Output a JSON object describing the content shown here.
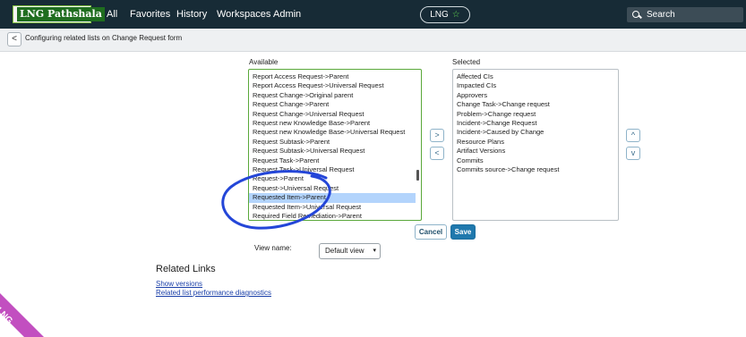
{
  "nav": {
    "logo_text": "LNG Pathshala",
    "links": [
      "All",
      "Favorites",
      "History",
      "Workspaces",
      "Admin"
    ],
    "scope": "LNG",
    "search_placeholder": "Search"
  },
  "header": {
    "back_symbol": "<",
    "title": "Configuring related lists on Change Request form"
  },
  "slushbucket": {
    "available_label": "Available",
    "selected_label": "Selected",
    "available_items": [
      "Report Access Request->Parent",
      "Report Access Request->Universal Request",
      "Request Change->Original parent",
      "Request Change->Parent",
      "Request Change->Universal Request",
      "Request new Knowledge Base->Parent",
      "Request new Knowledge Base->Universal Request",
      "Request Subtask->Parent",
      "Request Subtask->Universal Request",
      "Request Task->Parent",
      "Request Task->Universal Request",
      "Request->Parent",
      "Request->Universal Request",
      "Requested Item->Parent",
      "Requested Item->Universal Request",
      "Required Field Remediation->Parent"
    ],
    "available_selected_index": 13,
    "selected_items": [
      "Affected CIs",
      "Impacted CIs",
      "Approvers",
      "Change Task->Change request",
      "Problem->Change request",
      "Incident->Change Request",
      "Incident->Caused by Change",
      "Resource Plans",
      "Artifact Versions",
      "Commits",
      "Commits source->Change request"
    ],
    "add_symbol": ">",
    "remove_symbol": "<",
    "up_symbol": "^",
    "down_symbol": "v"
  },
  "actions": {
    "cancel_label": "Cancel",
    "save_label": "Save"
  },
  "view": {
    "label": "View name:",
    "selected": "Default view"
  },
  "related_links": {
    "heading": "Related Links",
    "links": [
      "Show versions",
      "Related list performance diagnostics"
    ]
  },
  "watermark": "LNG",
  "colors": {
    "nav_bg": "#172b36",
    "accent_green": "#5aa83a",
    "save_blue": "#1f78ad",
    "annotation_blue": "#2446d8",
    "watermark_pink": "#c24fc0"
  }
}
